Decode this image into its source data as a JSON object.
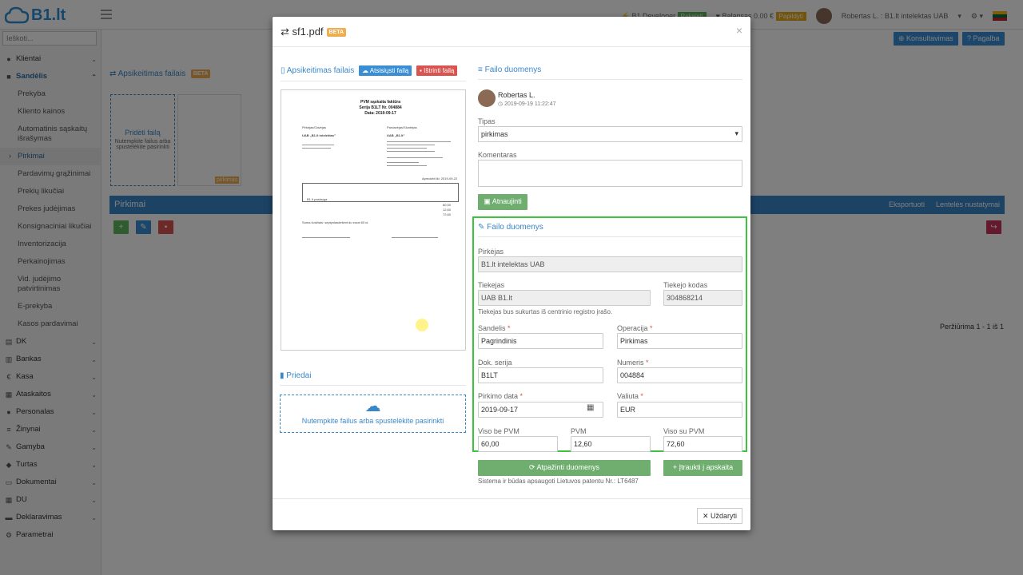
{
  "topbar": {
    "logo": "B1.lt",
    "user_status": "B1 Developer",
    "status_tag": "Pakeisti",
    "balance": "Balansas 0.00 €",
    "balance_tag": "Papildyti",
    "user": "Robertas L. : B1.lt intelektas UAB"
  },
  "sidebar": {
    "search_placeholder": "Ieškoti...",
    "items": [
      {
        "label": "Klientai",
        "icon": "user-icon"
      },
      {
        "label": "Sandėlis",
        "icon": "truck-icon"
      },
      {
        "label": "DK",
        "icon": "book-icon"
      },
      {
        "label": "Bankas",
        "icon": "bank-icon"
      },
      {
        "label": "Kasa",
        "icon": "euro-icon"
      },
      {
        "label": "Ataskaitos",
        "icon": "chart-icon"
      },
      {
        "label": "Personalas",
        "icon": "people-icon"
      },
      {
        "label": "Žinynai",
        "icon": "list-icon"
      },
      {
        "label": "Gamyba",
        "icon": "wrench-icon"
      },
      {
        "label": "Turtas",
        "icon": "car-icon"
      },
      {
        "label": "Dokumentai",
        "icon": "document-icon"
      },
      {
        "label": "DU",
        "icon": "grid-icon"
      },
      {
        "label": "Deklaravimas",
        "icon": "folder-icon"
      },
      {
        "label": "Parametrai",
        "icon": "gear-icon"
      }
    ],
    "sub_items": [
      "Prekyba",
      "Kliento kainos",
      "Automatinis sąskaitų išrašymas",
      "Pirkimai",
      "Pardavimų grąžinimai",
      "Prekių likučiai",
      "Prekes judėjimas",
      "Konsignaciniai likučiai",
      "Inventorizacija",
      "Perkainojimas",
      "Vid. judėjimo patvirtinimas",
      "E-prekyba",
      "Kasos pardavimai"
    ]
  },
  "background": {
    "btn_consult": "Konsultavimas",
    "btn_help": "Pagalba",
    "section_files": "Apsikeitimas failais",
    "add_file": "Pridėti failą",
    "add_file_hint": "Nutempkite failus arba spustelėkite pasirinkti",
    "thumb_tag": "pirkimas",
    "panel_title": "Pirkimai",
    "export": "Eksportuoti",
    "table_settings": "Lentelės nustatymai",
    "pager": "Peržiūrima 1 - 1 iš 1"
  },
  "modal": {
    "title": "sf1.pdf",
    "beta": "BETA",
    "left_section": "Apsikeitimas failais",
    "btn_download": "Atsisiųsti failą",
    "btn_delete": "Ištrinti failą",
    "attachments": "Priedai",
    "dropzone_text": "Nutempkite failus arba spustelėkite pasirinkti",
    "right_section": "Failo duomenys",
    "author": "Robertas L.",
    "timestamp": "2019-09-19 11:22:47",
    "type_label": "Tipas",
    "type_value": "pirkimas",
    "comment_label": "Komentaras",
    "btn_update": "Atnaujinti",
    "box_title": "Failo duomenys",
    "buyer_label": "Pirkėjas",
    "buyer_value": "B1.lt intelektas UAB",
    "supplier_label": "Tiekejas",
    "supplier_value": "UAB  B1.lt",
    "supplier_code_label": "Tiekejo kodas",
    "supplier_code_value": "304868214",
    "supplier_hint": "Tiekejas bus sukurtas iš centrinio registro įrašo.",
    "warehouse_label": "Sandelis",
    "warehouse_value": "Pagrindinis",
    "operation_label": "Operacija",
    "operation_value": "Pirkimas",
    "doc_series_label": "Dok. serija",
    "doc_series_value": "B1LT",
    "number_label": "Numeris",
    "number_value": "004884",
    "purchase_date_label": "Pirkimo data",
    "purchase_date_value": "2019-09-17",
    "currency_label": "Valiuta",
    "currency_value": "EUR",
    "net_label": "Viso be PVM",
    "net_value": "60,00",
    "vat_label": "PVM",
    "vat_value": "12,60",
    "gross_label": "Viso su PVM",
    "gross_value": "72,60",
    "btn_recognize": "Atpažinti duomenys",
    "btn_include": "Įtraukti į apskaita",
    "patent": "Sistema ir būdas apsaugoti Lietuvos patentu Nr.: LT6487",
    "btn_close": "Uždaryti"
  },
  "invoice_preview": {
    "title": "PVM sąskaita faktūra",
    "series": "Serija B1LT Nr. 004884",
    "date": "Data: 2019-09-17",
    "buyer_hdr": "Pirkėjas/Gavėjas",
    "seller_hdr": "Pardavėjas/Siuntėjas",
    "buyer_name": "UAB „B1.lt intelektas\"",
    "seller_name": "UAB „B1.lt\"",
    "due": "Apmokėti iki: 2019-09-22",
    "item": "B1.lt paslauga",
    "total": "60,00",
    "vat": "12,60",
    "sum": "72,60",
    "words": "Suma žodžiais: septyniasdešimt du eurai 60 ct."
  }
}
